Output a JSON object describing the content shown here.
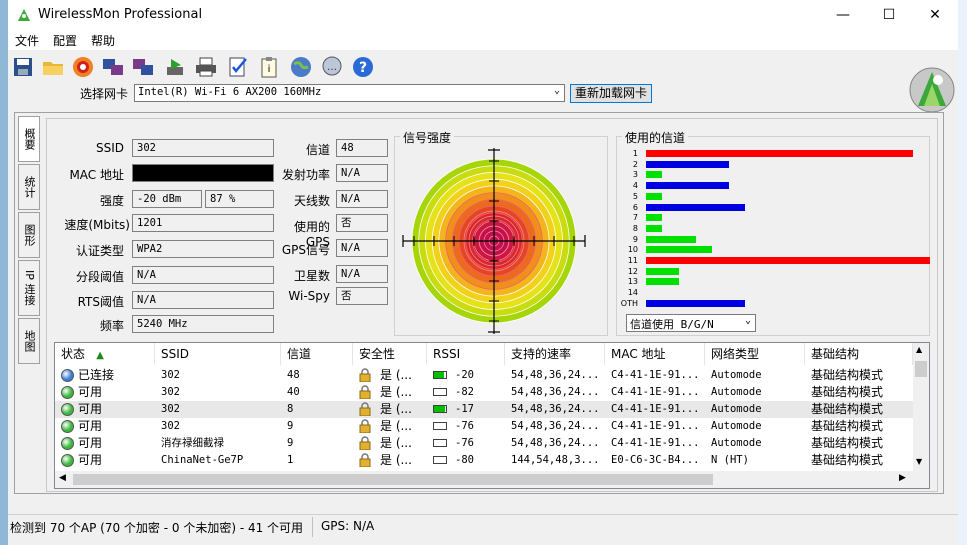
{
  "window": {
    "title": "WirelessMon Professional",
    "minimize": "—",
    "maximize": "☐",
    "close": "✕"
  },
  "menu": [
    "文件",
    "配置",
    "帮助"
  ],
  "toolbar_icons": [
    "save-icon",
    "open-folder-icon",
    "record-icon",
    "network-card-icon",
    "network-card-2-icon",
    "export-icon",
    "printer-icon",
    "checklist-icon",
    "clipboard-icon",
    "globe-icon",
    "chat-icon",
    "help-icon"
  ],
  "adapter": {
    "label": "选择网卡",
    "selected": "Intel(R) Wi-Fi 6 AX200 160MHz",
    "reload": "重新加载网卡"
  },
  "vtabs": [
    "概要",
    "统计",
    "图形",
    "IP 连接",
    "地图"
  ],
  "summary": {
    "ssid_label": "SSID",
    "ssid": "302",
    "mac_label": "MAC 地址",
    "strength_label": "强度",
    "strength_dbm": "-20 dBm",
    "strength_pct": "87 %",
    "speed_label": "速度(Mbits)",
    "speed": "1201",
    "auth_label": "认证类型",
    "auth": "WPA2",
    "frag_label": "分段阈值",
    "frag": "N/A",
    "rts_label": "RTS阈值",
    "rts": "N/A",
    "freq_label": "频率",
    "freq": "5240 MHz",
    "channel_label": "信道",
    "channel": "48",
    "txpower_label": "发射功率",
    "txpower": "N/A",
    "antenna_label": "天线数",
    "antenna": "N/A",
    "gps_label": "使用的GPS",
    "gps": "否",
    "gpssignal_label": "GPS信号",
    "gpssignal": "N/A",
    "satellites_label": "卫星数",
    "satellites": "N/A",
    "wispy_label": "Wi-Spy",
    "wispy": "否"
  },
  "signal": {
    "title": "信号强度",
    "ring_colors": [
      "#a6d608",
      "#c8dc10",
      "#e6e21a",
      "#f2d11a",
      "#f4b41c",
      "#f0901c",
      "#ec6a1e",
      "#e44624",
      "#d8282c",
      "#cc1840",
      "#c01050"
    ],
    "level_percent": 87
  },
  "channels": {
    "title": "使用的信道",
    "filter": "信道使用 B/G/N",
    "items": [
      {
        "label": "1",
        "value": 263,
        "color": "#ff0000"
      },
      {
        "label": "2",
        "value": 82,
        "color": "#0000e0"
      },
      {
        "label": "3",
        "value": 16,
        "color": "#00e000"
      },
      {
        "label": "4",
        "value": 82,
        "color": "#0000e0"
      },
      {
        "label": "5",
        "value": 16,
        "color": "#00e000"
      },
      {
        "label": "6",
        "value": 98,
        "color": "#0000e0"
      },
      {
        "label": "7",
        "value": 16,
        "color": "#00e000"
      },
      {
        "label": "8",
        "value": 16,
        "color": "#00e000"
      },
      {
        "label": "9",
        "value": 49,
        "color": "#00e000"
      },
      {
        "label": "10",
        "value": 65,
        "color": "#00e000"
      },
      {
        "label": "11",
        "value": 280,
        "color": "#ff0000"
      },
      {
        "label": "12",
        "value": 33,
        "color": "#00e000"
      },
      {
        "label": "13",
        "value": 33,
        "color": "#00e000"
      },
      {
        "label": "14",
        "value": 0,
        "color": "#00e000"
      },
      {
        "label": "OTH",
        "value": 98,
        "color": "#0000e0"
      }
    ],
    "max": 280
  },
  "table": {
    "columns": [
      "状态",
      "SSID",
      "信道",
      "安全性",
      "RSSI",
      "支持的速率",
      "MAC 地址",
      "网络类型",
      "基础结构"
    ],
    "rows": [
      {
        "status": "已连接",
        "ssid": "302",
        "channel": "48",
        "security": "是 (...",
        "rssi": "-20",
        "rssi_level": 0.87,
        "rates": "54,48,36,24...",
        "mac": "C4-41-1E-91...",
        "nettype": "Automode",
        "infra": "基础结构模式",
        "dot": "#3a7fd6"
      },
      {
        "status": "可用",
        "ssid": "302",
        "channel": "40",
        "security": "是 (...",
        "rssi": "-82",
        "rssi_level": 0.0,
        "rates": "54,48,36,24...",
        "mac": "C4-41-1E-91...",
        "nettype": "Automode",
        "infra": "基础结构模式",
        "dot": "#3cb83c"
      },
      {
        "status": "可用",
        "ssid": "302",
        "channel": "8",
        "security": "是 (...",
        "rssi": "-17",
        "rssi_level": 0.9,
        "rates": "54,48,36,24...",
        "mac": "C4-41-1E-91...",
        "nettype": "Automode",
        "infra": "基础结构模式",
        "dot": "#3cb83c"
      },
      {
        "status": "可用",
        "ssid": "302",
        "channel": "9",
        "security": "是 (...",
        "rssi": "-76",
        "rssi_level": 0.0,
        "rates": "54,48,36,24...",
        "mac": "C4-41-1E-91...",
        "nettype": "Automode",
        "infra": "基础结构模式",
        "dot": "#3cb83c"
      },
      {
        "status": "可用",
        "ssid": "消存禄细截禄",
        "channel": "9",
        "security": "是 (...",
        "rssi": "-76",
        "rssi_level": 0.0,
        "rates": "54,48,36,24...",
        "mac": "C4-41-1E-91...",
        "nettype": "Automode",
        "infra": "基础结构模式",
        "dot": "#3cb83c"
      },
      {
        "status": "可用",
        "ssid": "ChinaNet-Ge7P",
        "channel": "1",
        "security": "是 (...",
        "rssi": "-80",
        "rssi_level": 0.0,
        "rates": "144,54,48,3...",
        "mac": "E0-C6-3C-B4...",
        "nettype": "N (HT)",
        "infra": "基础结构模式",
        "dot": "#3cb83c"
      }
    ]
  },
  "statusbar": {
    "ap_summary": "检测到 70 个AP (70 个加密 - 0 个未加密) - 41 个可用",
    "gps": "GPS: N/A"
  }
}
